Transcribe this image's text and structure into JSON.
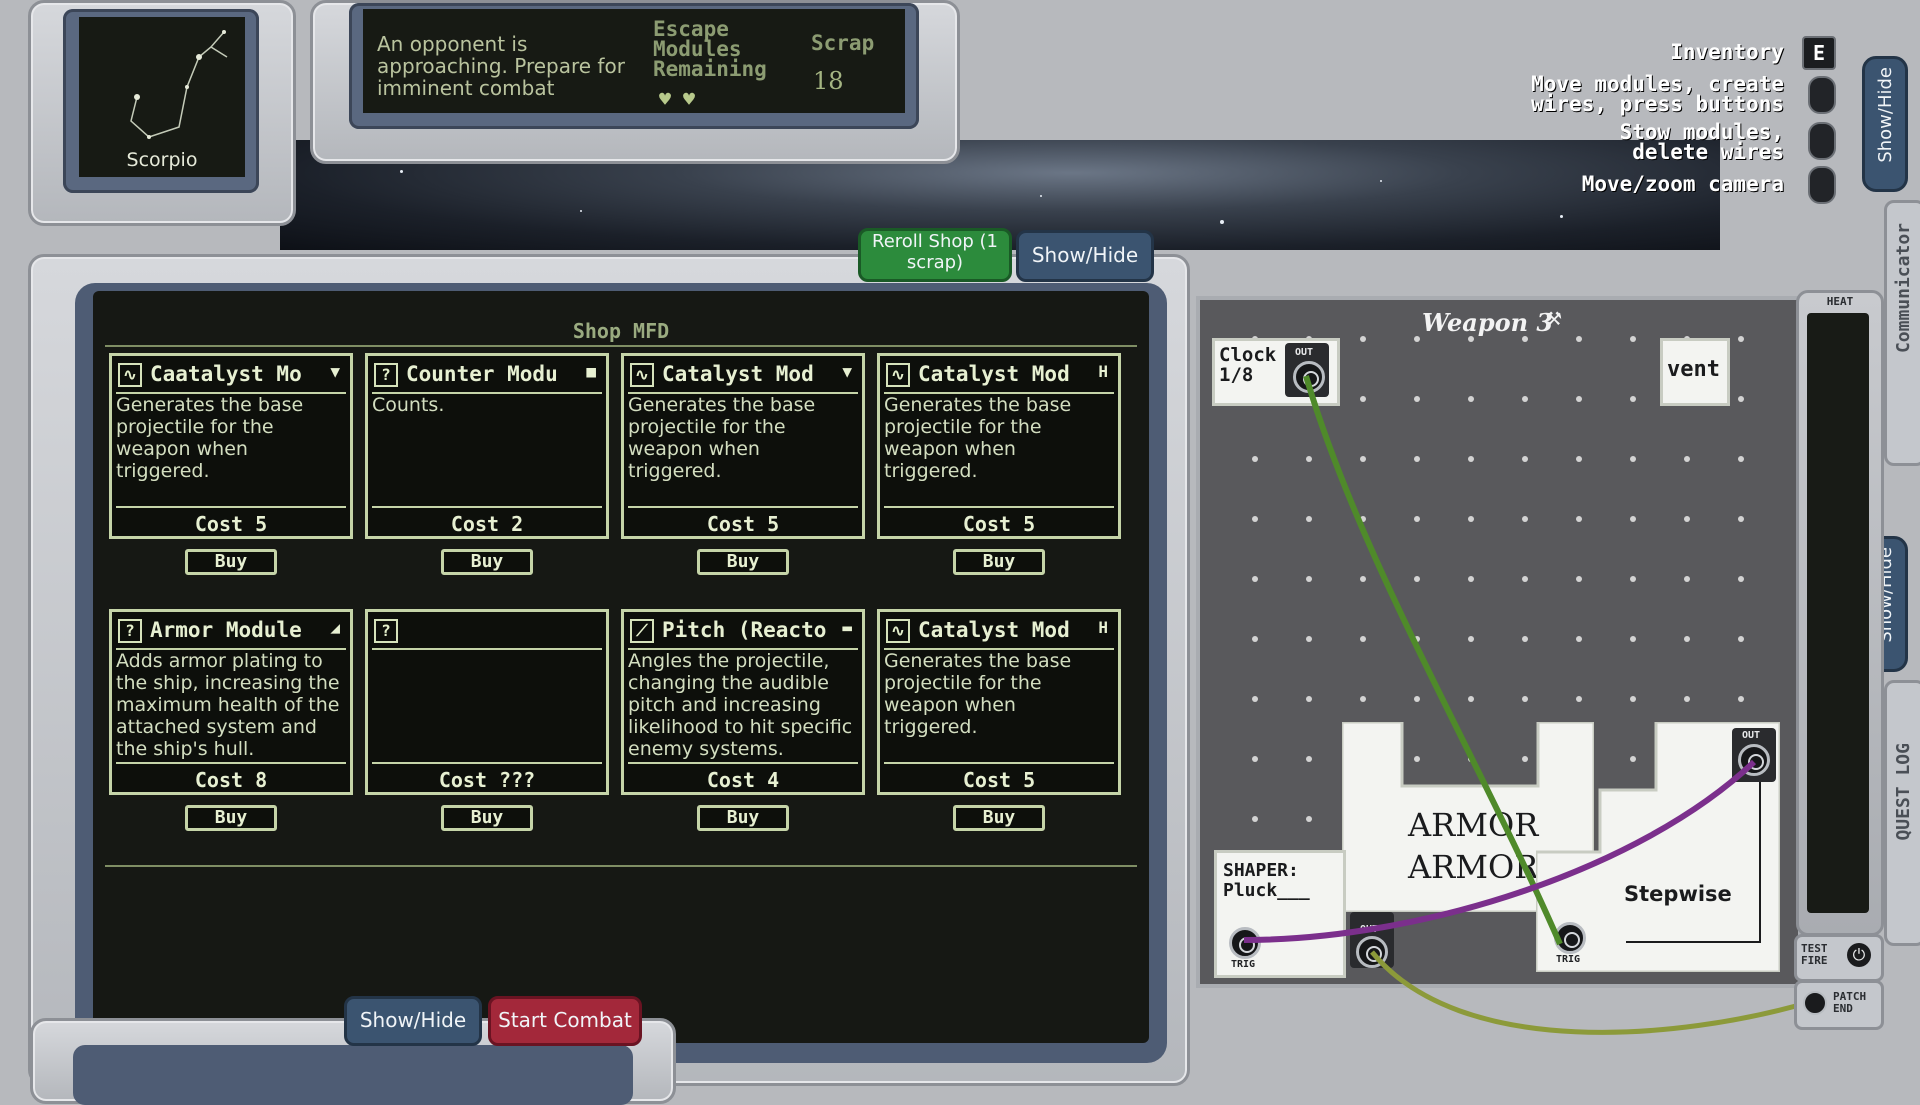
{
  "constellation": {
    "name": "Scorpio"
  },
  "status": {
    "message": "An opponent is approaching. Prepare for imminent combat",
    "escape_label": "Escape Modules Remaining",
    "scrap_label": "Scrap",
    "scrap_value": "18",
    "escape_modules_remaining": 2
  },
  "shop": {
    "title": "Shop MFD",
    "reroll_label": "Reroll Shop (1 scrap)",
    "showhide_label": "Show/Hide",
    "buy_label": "Buy",
    "items": [
      {
        "name": "Caatalyst Mo",
        "icon": "waveform-icon",
        "mark": "▼",
        "desc": "Generates the base projectile for the weapon when triggered.",
        "cost": "Cost 5"
      },
      {
        "name": "Counter Modu",
        "icon": "question-icon",
        "mark": "■",
        "desc": "Counts.",
        "cost": "Cost 2"
      },
      {
        "name": "Catalyst Mod",
        "icon": "waveform-icon",
        "mark": "▼",
        "desc": "Generates the base projectile for the weapon when triggered.",
        "cost": "Cost 5"
      },
      {
        "name": "Catalyst Mod",
        "icon": "waveform-icon",
        "mark": "H",
        "desc": "Generates the base projectile for the weapon when triggered.",
        "cost": "Cost 5"
      },
      {
        "name": "Armor Module",
        "icon": "question-icon",
        "mark": "◢",
        "desc": "Adds armor plating to the ship, increasing the maximum health of the attached system and the ship's hull.",
        "cost": "Cost 8"
      },
      {
        "name": "",
        "icon": "question-icon",
        "mark": "",
        "desc": "",
        "cost": "Cost ???"
      },
      {
        "name": "Pitch (Reacto",
        "icon": "slope-icon",
        "mark": "▬",
        "desc": "Angles the projectile, changing the audible pitch and increasing likelihood to hit specific enemy systems.",
        "cost": "Cost 4"
      },
      {
        "name": "Catalyst Mod",
        "icon": "waveform-icon",
        "mark": "H",
        "desc": "Generates the base projectile for the weapon when triggered.",
        "cost": "Cost 5"
      }
    ]
  },
  "bottom": {
    "showhide_label": "Show/Hide",
    "start_combat_label": "Start Combat"
  },
  "controls": {
    "inventory_label": "Inventory",
    "inventory_key": "E",
    "move_label": "Move modules, create wires, press buttons",
    "stow_label": "Stow modules, delete wires",
    "camera_label": "Move/zoom camera"
  },
  "side": {
    "showhide_top": "Show/Hide",
    "communicator": "Communicator",
    "showhide_bottom": "Show/Hide",
    "quest_log": "QUEST LOG"
  },
  "weapon": {
    "title": "Weapon 3",
    "clock_label": "Clock 1/8",
    "vent_label": "vent",
    "armor_line1": "ARMOR",
    "armor_line2": "ARMOR",
    "shaper_label": "SHAPER: Pluck___",
    "stepwise_label": "Stepwise",
    "out_label": "OUT",
    "trig_label": "TRIG"
  },
  "heat": {
    "label": "HEAT",
    "test_fire": "TEST FIRE",
    "patch_end": "PATCH END"
  },
  "colors": {
    "screen_text": "#c8d6a6",
    "reroll": "#2c8b3c",
    "start_combat": "#a3283a",
    "showhide": "#3b5470",
    "wire_green": "#4f8a2a",
    "wire_purple": "#7b2f8c",
    "wire_olive": "#8c9a3a"
  }
}
